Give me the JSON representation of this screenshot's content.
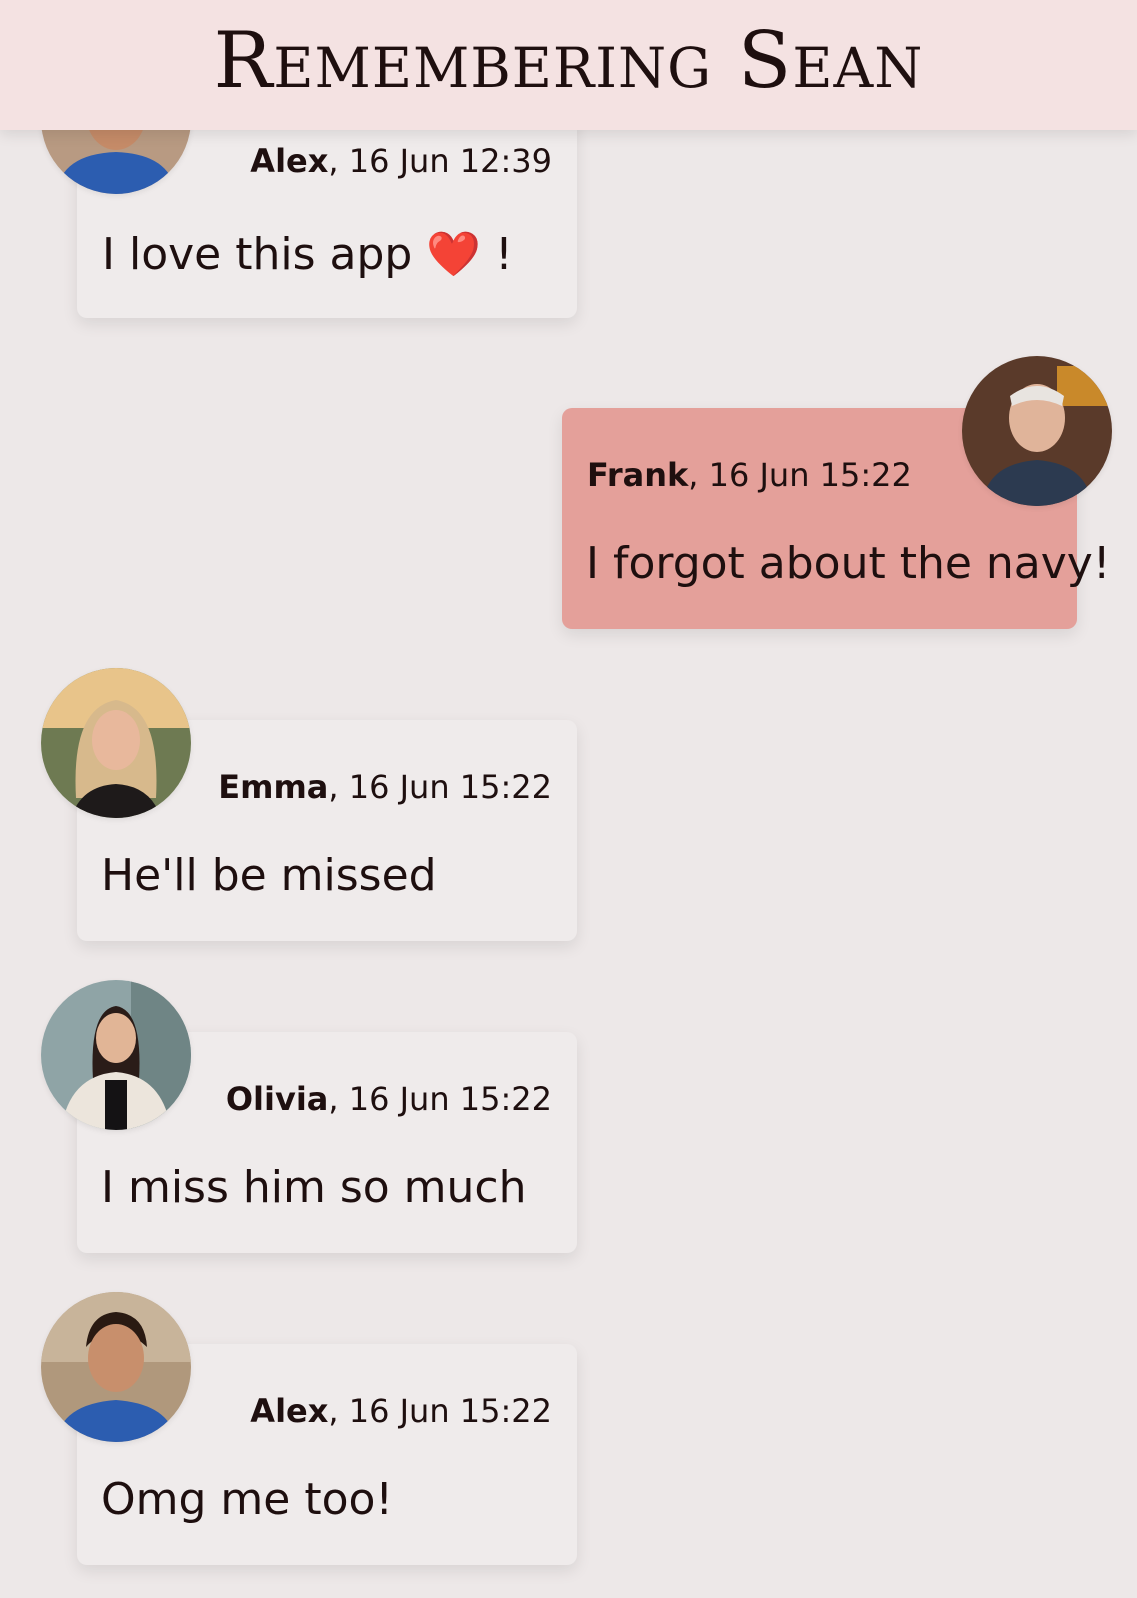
{
  "header": {
    "title": "Remembering Sean"
  },
  "messages": [
    {
      "author": "Alex",
      "time": ", 16 Jun 12:39",
      "text": "I love this app",
      "emoji": "❤️",
      "suffix": " !",
      "mine": false,
      "avatar": "alex-avatar"
    },
    {
      "author": "Frank",
      "time": ", 16 Jun 15:22",
      "text": "I forgot about the navy!",
      "mine": true,
      "avatar": "frank-avatar"
    },
    {
      "author": "Emma",
      "time": ", 16 Jun 15:22",
      "text": "He'll be missed",
      "mine": false,
      "avatar": "emma-avatar"
    },
    {
      "author": "Olivia",
      "time": ", 16 Jun 15:22",
      "text": "I miss him so much",
      "mine": false,
      "avatar": "olivia-avatar"
    },
    {
      "author": "Alex",
      "time": ", 16 Jun 15:22",
      "text": "Omg me too!",
      "mine": false,
      "avatar": "alex-avatar"
    }
  ],
  "colors": {
    "background": "#ede8e8",
    "header": "#f4e2e2",
    "bubble": "#efebeb",
    "bubble_mine": "#e4a09a",
    "text": "#1e0f0f"
  }
}
